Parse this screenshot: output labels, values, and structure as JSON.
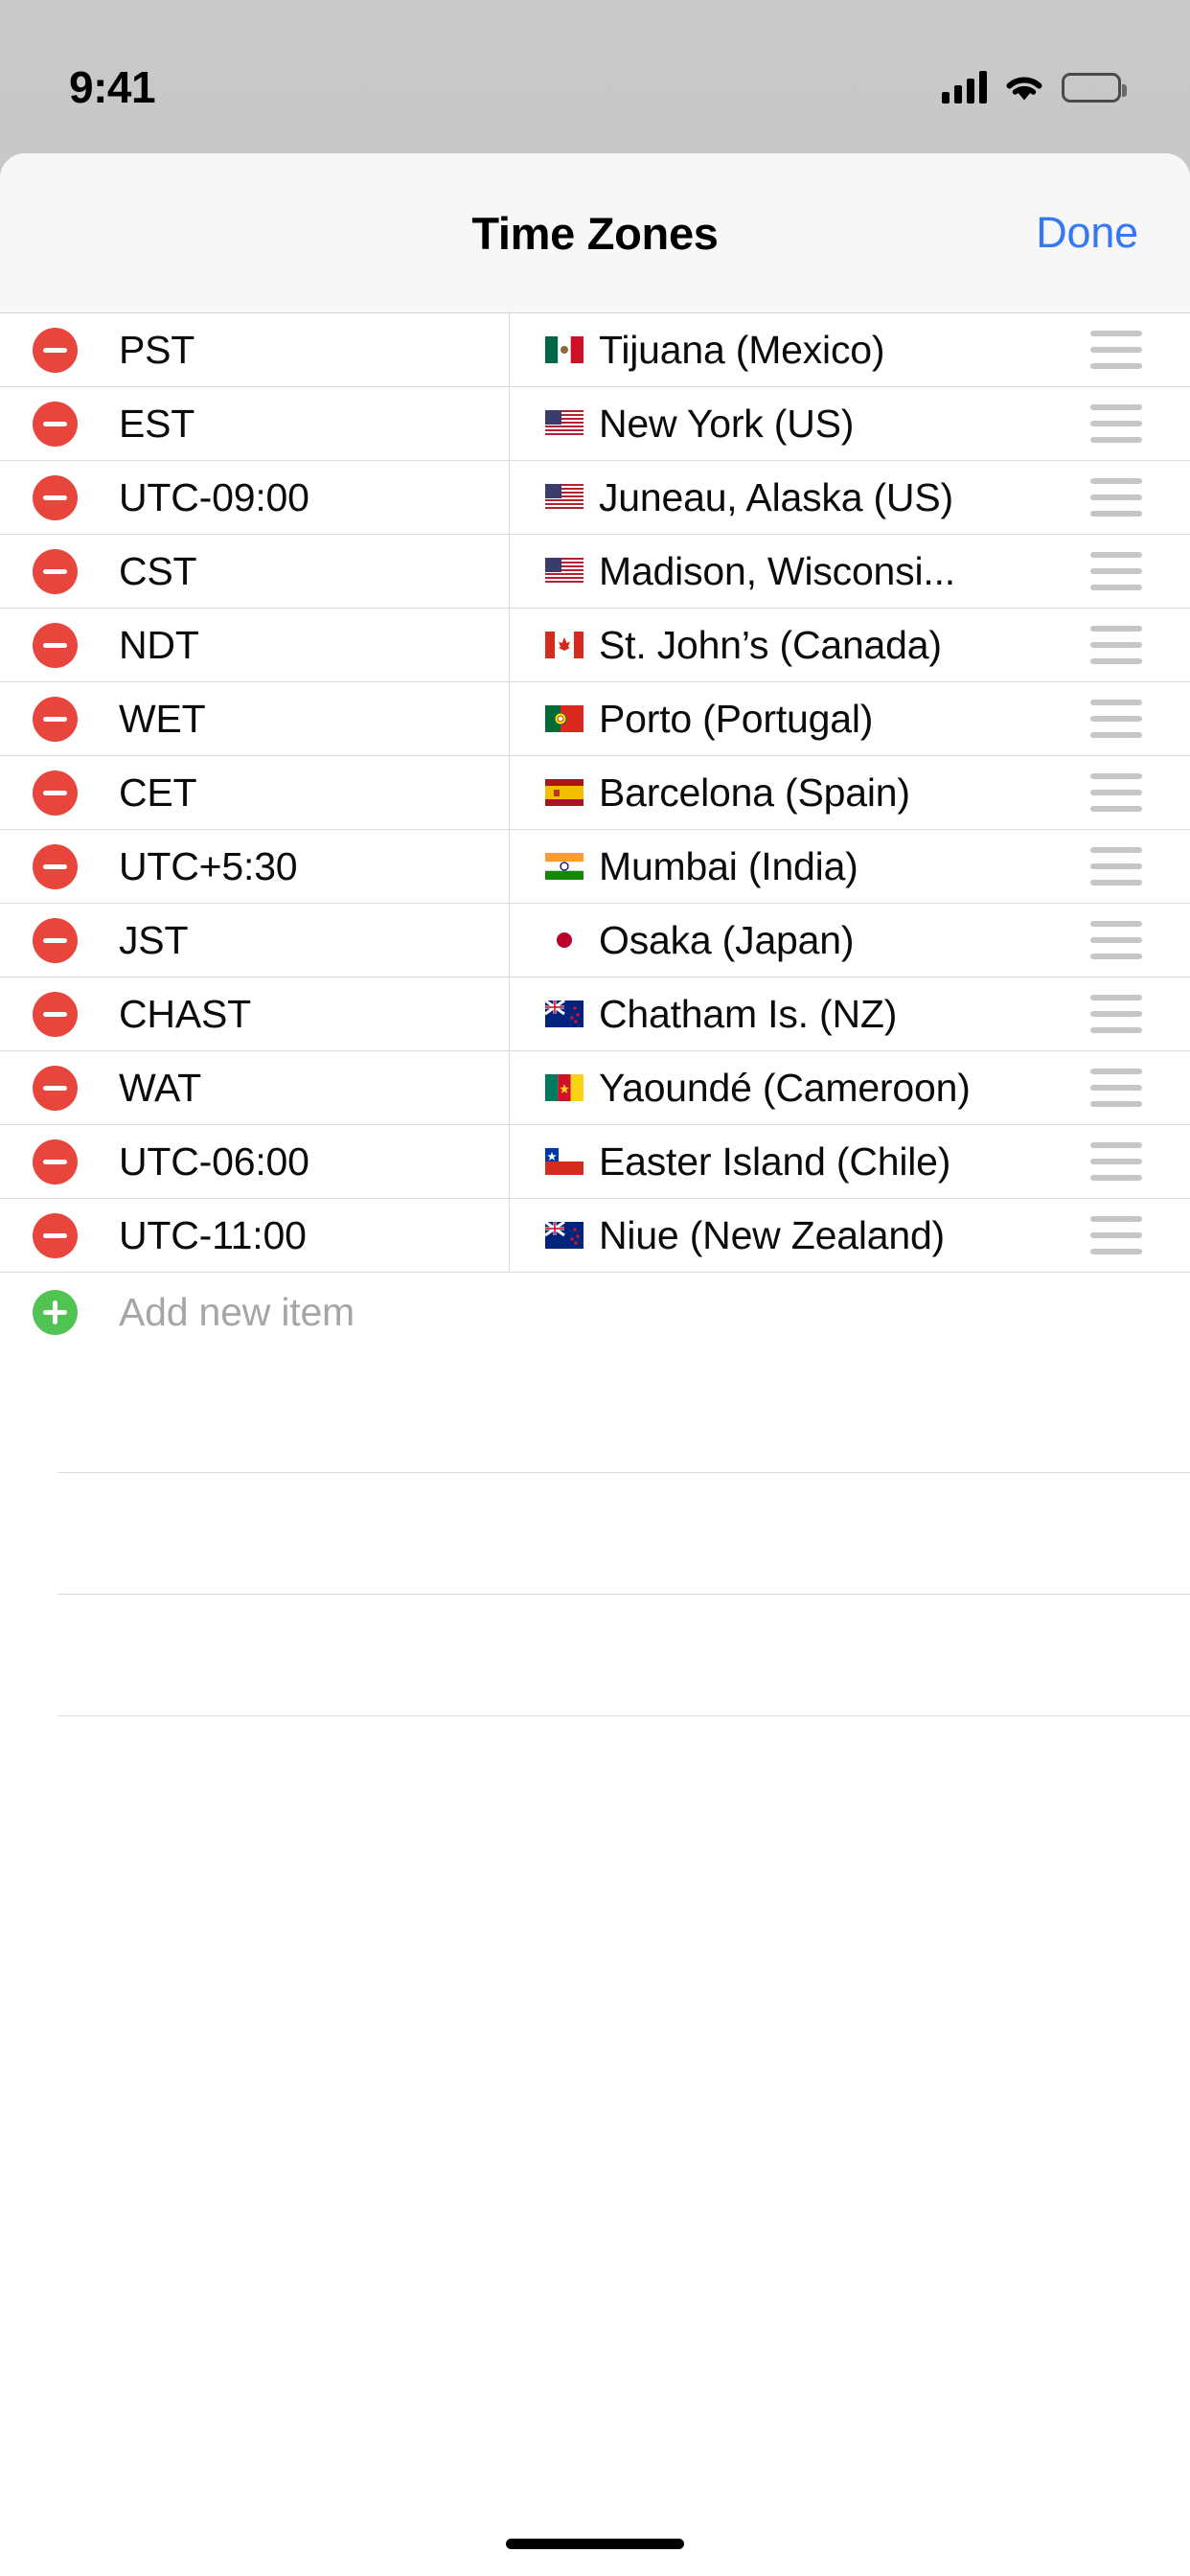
{
  "status_bar": {
    "time": "9:41",
    "signal_icon": "cellular-signal-icon",
    "wifi_icon": "wifi-icon",
    "battery_icon": "battery-full-icon"
  },
  "navbar": {
    "title": "Time Zones",
    "done_label": "Done"
  },
  "colors": {
    "accent_blue": "#3478f6",
    "delete_red": "#e8453c",
    "add_green": "#51c353",
    "separator": "#dcdcdc",
    "placeholder_gray": "#a6a6a8",
    "navbar_bg": "#f7f7f7"
  },
  "list": {
    "columns": [
      "abbreviation",
      "city"
    ],
    "rows": [
      {
        "abbr": "PST",
        "flag": "mx",
        "flag_name": "flag-mexico",
        "city": "Tijuana (Mexico)"
      },
      {
        "abbr": "EST",
        "flag": "us",
        "flag_name": "flag-united-states",
        "city": "New York (US)"
      },
      {
        "abbr": "UTC-09:00",
        "flag": "us",
        "flag_name": "flag-united-states",
        "city": "Juneau, Alaska (US)"
      },
      {
        "abbr": "CST",
        "flag": "us",
        "flag_name": "flag-united-states",
        "city": "Madison, Wisconsi..."
      },
      {
        "abbr": "NDT",
        "flag": "ca",
        "flag_name": "flag-canada",
        "city": "St. John’s (Canada)"
      },
      {
        "abbr": "WET",
        "flag": "pt",
        "flag_name": "flag-portugal",
        "city": "Porto (Portugal)"
      },
      {
        "abbr": "CET",
        "flag": "es",
        "flag_name": "flag-spain",
        "city": "Barcelona (Spain)"
      },
      {
        "abbr": "UTC+5:30",
        "flag": "in",
        "flag_name": "flag-india",
        "city": "Mumbai (India)"
      },
      {
        "abbr": "JST",
        "flag": "jp",
        "flag_name": "flag-japan",
        "city": "Osaka (Japan)"
      },
      {
        "abbr": "CHAST",
        "flag": "nz",
        "flag_name": "flag-new-zealand",
        "city": "Chatham Is. (NZ)"
      },
      {
        "abbr": "WAT",
        "flag": "cm",
        "flag_name": "flag-cameroon",
        "city": "Yaoundé (Cameroon)"
      },
      {
        "abbr": "UTC-06:00",
        "flag": "cl",
        "flag_name": "flag-chile",
        "city": "Easter Island (Chile)"
      },
      {
        "abbr": "UTC-11:00",
        "flag": "nz",
        "flag_name": "flag-new-zealand",
        "city": "Niue (New Zealand)"
      }
    ],
    "delete_icon": "minus-circle-icon",
    "drag_icon": "drag-handle-icon"
  },
  "add_row": {
    "placeholder": "Add new item",
    "icon": "plus-circle-icon"
  },
  "empty_rows_count": 3,
  "home_indicator": "home-indicator-bar"
}
